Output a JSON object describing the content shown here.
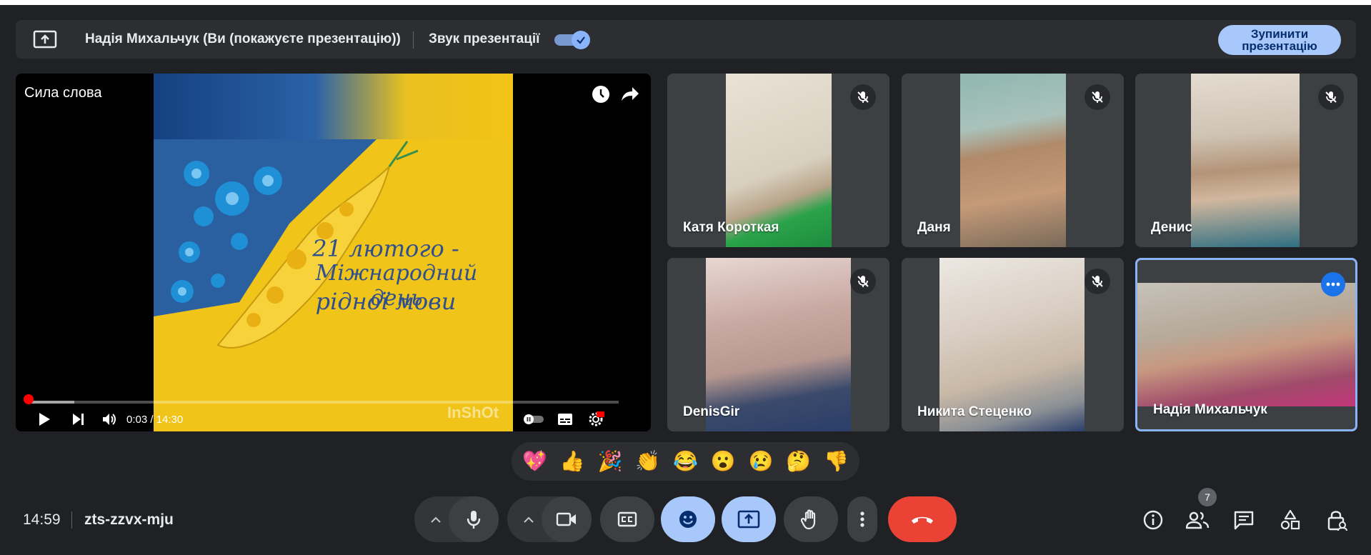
{
  "banner": {
    "title": "Надія Михальчук (Ви (покажуєте презентацію))",
    "sound_label": "Звук презентації",
    "sound_enabled": true,
    "stop_button": "Зупинити презентацію"
  },
  "player": {
    "title": "Сила слова",
    "slide_line1": "21 лютого -",
    "slide_line2": "Міжнародний день",
    "slide_line3": "рідної мови",
    "time": "0:03 / 14:30",
    "watermark": "InShOt",
    "progress_fraction": 0.0034
  },
  "participants": [
    {
      "name": "Катя Короткая",
      "muted": true
    },
    {
      "name": "Даня",
      "muted": true
    },
    {
      "name": "Денис",
      "muted": true
    },
    {
      "name": "DenisGir",
      "muted": true
    },
    {
      "name": "Никита Стеценко",
      "muted": true
    },
    {
      "name": "Надія Михальчук",
      "muted": false,
      "active": true
    }
  ],
  "reactions": [
    "💖",
    "👍",
    "🎉",
    "👏",
    "😂",
    "😮",
    "😢",
    "🤔",
    "👎"
  ],
  "bottom": {
    "time": "14:59",
    "meeting_code": "zts-zzvx-mju",
    "participants_count": "7"
  },
  "colors": {
    "background": "#202124",
    "accent": "#8ab4f8",
    "end_call": "#ea4335",
    "active_button": "#a8c7fa"
  }
}
